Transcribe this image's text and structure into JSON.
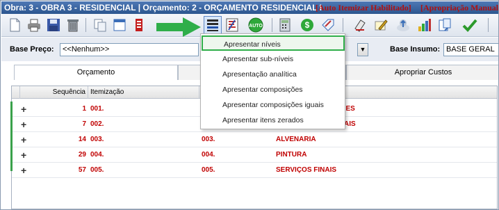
{
  "window": {
    "title": "Obra: 3 - OBRA 3 - RESIDENCIAL | Orçamento: 2 - ORÇAMENTO RESIDENCIAL I",
    "flag_auto": "[Auto Itemizar Habilitado]",
    "flag_apropriacao": "[Apropriação Manual]"
  },
  "toolbar": {
    "icons": [
      "new-document-icon",
      "print-icon",
      "save-icon",
      "trash-icon",
      "copy-icon",
      "window-icon",
      "list-red-icon",
      "levels-menu-icon",
      "sort-icon",
      "auto-button-icon",
      "calculator-icon",
      "money-icon",
      "tag-icon",
      "stamp-icon",
      "pencil-icon",
      "upload-icon",
      "bar-chart-icon",
      "paste-icon",
      "checkmark-icon"
    ],
    "auto_label": "AUTO",
    "money_label": "$"
  },
  "filters": {
    "base_preco_label": "Base Preço:",
    "base_preco_value": "<<Nenhum>>",
    "base_insumo_label": "Base Insumo:",
    "base_insumo_value": "BASE GERAL"
  },
  "tabs": [
    {
      "label": "Orçamento"
    },
    {
      "label": ""
    },
    {
      "label": "Apropriar Custos"
    }
  ],
  "grid": {
    "headers": {
      "sequencia": "Sequência",
      "itemizacao": "Itemização"
    },
    "rows": [
      {
        "seq": "1",
        "item": "001.",
        "code": "",
        "desc": "ARES"
      },
      {
        "seq": "7",
        "item": "002.",
        "code": "",
        "desc": "AIS"
      },
      {
        "seq": "14",
        "item": "003.",
        "code": "003.",
        "desc": "ALVENARIA"
      },
      {
        "seq": "29",
        "item": "004.",
        "code": "004.",
        "desc": "PINTURA"
      },
      {
        "seq": "57",
        "item": "005.",
        "code": "005.",
        "desc": "SERVIÇOS FINAIS"
      }
    ],
    "expand_symbol": "+"
  },
  "menu": {
    "items": [
      {
        "label": "Apresentar níveis"
      },
      {
        "label": "Apresentar sub-níveis"
      },
      {
        "label": "Apresentação analítica"
      },
      {
        "label": "Apresentar composições"
      },
      {
        "label": "Apresentar composições iguais"
      },
      {
        "label": "Apresentar itens zerados"
      }
    ]
  },
  "colors": {
    "accent_green": "#2fae4a",
    "row_text": "#c00000",
    "title_flag": "#b01010"
  }
}
